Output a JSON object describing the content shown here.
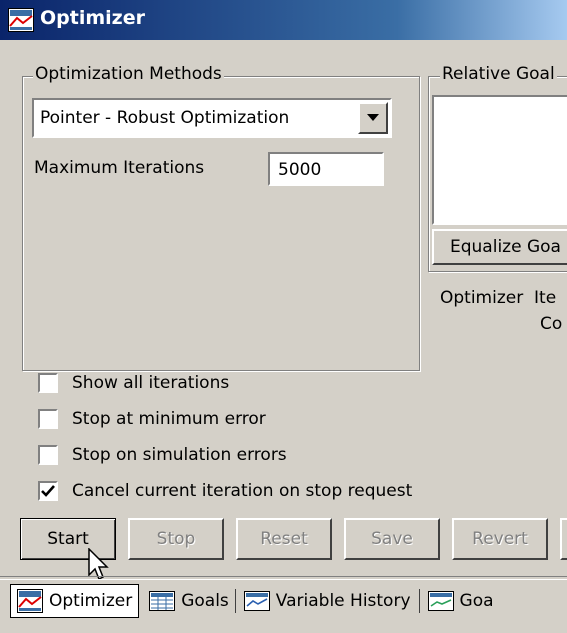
{
  "window": {
    "title": "Optimizer",
    "icon": "optimizer-app-icon"
  },
  "methods": {
    "legend": "Optimization Methods",
    "selected": "Pointer - Robust Optimization",
    "max_iter_label": "Maximum Iterations",
    "max_iter_value": "5000"
  },
  "goals_panel": {
    "legend": "Relative Goal",
    "equalize_button": "Equalize Goa",
    "status_line1": "Optimizer  Ite",
    "status_line2": "Co"
  },
  "options": [
    {
      "label": "Show all iterations",
      "checked": false
    },
    {
      "label": "Stop at minimum error",
      "checked": false
    },
    {
      "label": "Stop on simulation errors",
      "checked": false
    },
    {
      "label": "Cancel current iteration on stop request",
      "checked": true
    }
  ],
  "buttons": {
    "start": "Start",
    "stop": "Stop",
    "reset": "Reset",
    "save": "Save",
    "revert": "Revert"
  },
  "tabs": [
    {
      "label": "Optimizer",
      "icon": "optimizer-icon",
      "active": true
    },
    {
      "label": "Goals",
      "icon": "goals-icon",
      "active": false
    },
    {
      "label": "Variable History",
      "icon": "chart-icon",
      "active": false
    },
    {
      "label": "Goa",
      "icon": "chart-icon",
      "active": false
    }
  ],
  "colors": {
    "title_bar": "#0a246a",
    "face": "#d4d0c8"
  }
}
